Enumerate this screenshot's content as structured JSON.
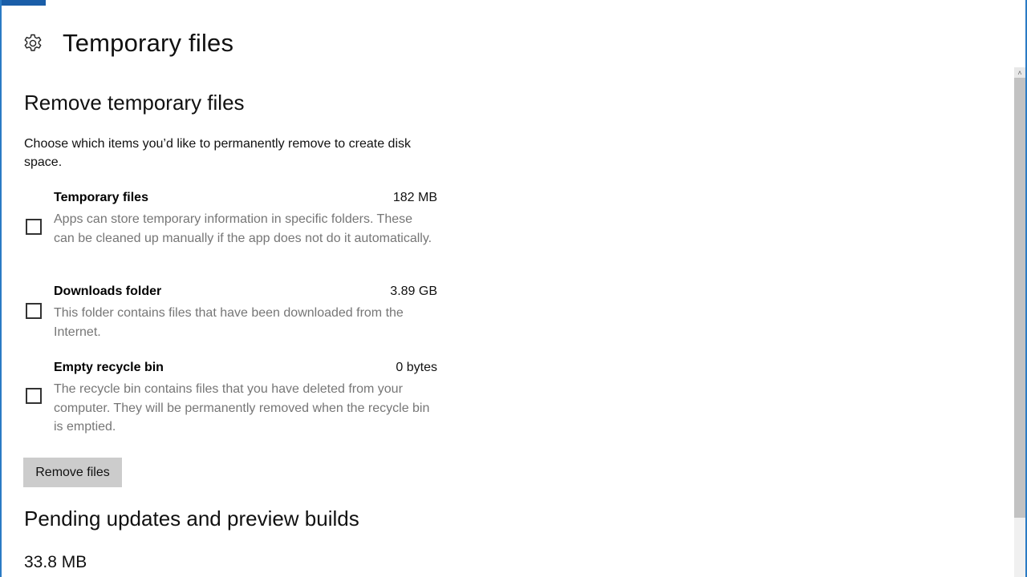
{
  "header": {
    "icon": "gear-icon",
    "title": "Temporary files"
  },
  "remove_section": {
    "title": "Remove temporary files",
    "description": "Choose which items you’d like to permanently remove to create disk space.",
    "items": [
      {
        "title": "Temporary files",
        "size": "182 MB",
        "description": "Apps can store temporary information in specific folders. These can be cleaned up manually if the app does not do it automatically.",
        "checked": false
      },
      {
        "title": "Downloads folder",
        "size": "3.89 GB",
        "description": "This folder contains files that have been downloaded from the Internet.",
        "checked": false
      },
      {
        "title": "Empty recycle bin",
        "size": "0 bytes",
        "description": "The recycle bin contains files that you have deleted from your computer. They will be permanently removed when the recycle bin is emptied.",
        "checked": false
      }
    ],
    "button_label": "Remove files"
  },
  "pending_section": {
    "title": "Pending updates and preview builds",
    "size": "33.8 MB"
  },
  "scrollbar": {
    "up_arrow": "˄"
  },
  "colors": {
    "accent": "#2b7bc4",
    "button_bg": "#cccccc",
    "secondary_text": "#767676"
  }
}
